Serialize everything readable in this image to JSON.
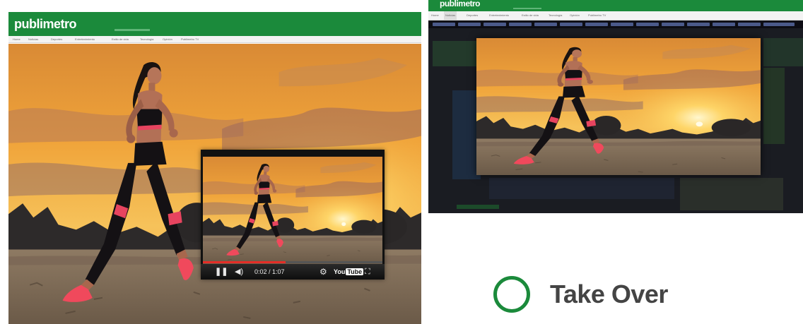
{
  "left_mock": {
    "brand": "publimetro",
    "nav_items": [
      "Home",
      "Noticias",
      "Deportes",
      "Entretenimiento",
      "Estilo de vida",
      "Tecnología",
      "Opinión",
      "Publimetro TV"
    ]
  },
  "right_mock": {
    "brand": "publimetro",
    "nav_items": [
      "Home",
      "Noticias",
      "Deportes",
      "Entretenimiento",
      "Estilo de vida",
      "Tecnología",
      "Opinión",
      "Publimetro TV"
    ]
  },
  "player": {
    "time": "0:02 / 1:07",
    "progress": 0.46,
    "youtube_label": "You",
    "youtube_tube": "Tube"
  },
  "caption": {
    "label": "Take Over"
  },
  "colors": {
    "brand_green": "#1b8a3b",
    "progress_red": "#e52d27"
  }
}
